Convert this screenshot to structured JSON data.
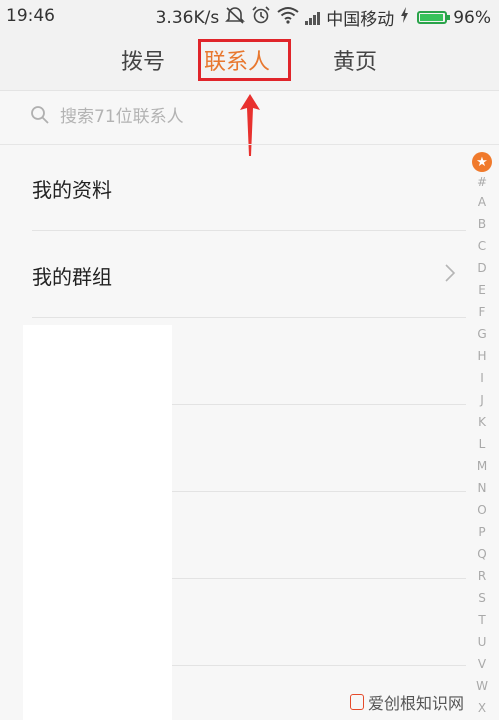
{
  "status_bar": {
    "time": "19:46",
    "speed": "3.36K/s",
    "carrier": "中国移动",
    "battery": "96%",
    "battery_level": 0.96
  },
  "tabs": [
    {
      "label": "拨号",
      "active": false
    },
    {
      "label": "联系人",
      "active": true
    },
    {
      "label": "黄页",
      "active": false
    }
  ],
  "accent_color": "#e8772e",
  "annotation_color": "#e0242a",
  "search": {
    "placeholder": "搜索71位联系人",
    "icon": "search-icon"
  },
  "list": [
    {
      "label": "我的资料",
      "has_chevron": false
    },
    {
      "label": "我的群组",
      "has_chevron": true
    }
  ],
  "index": {
    "star_icon": "star-icon",
    "letters": [
      "#",
      "A",
      "B",
      "C",
      "D",
      "E",
      "F",
      "G",
      "H",
      "I",
      "J",
      "K",
      "L",
      "M",
      "N",
      "O",
      "P",
      "Q",
      "R",
      "S",
      "T",
      "U",
      "V",
      "W",
      "X"
    ]
  },
  "watermark": {
    "text": "爱创根知识网"
  }
}
